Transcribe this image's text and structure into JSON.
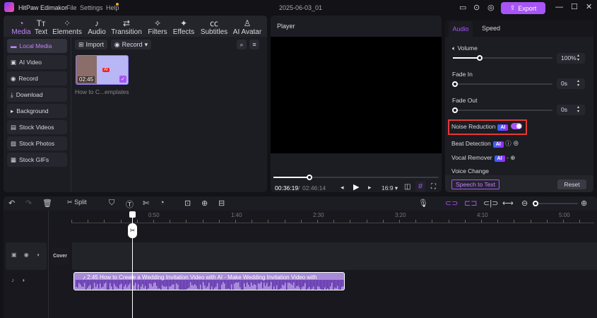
{
  "app": {
    "title": "HitPaw Edimakor",
    "menu": [
      "File",
      "Settings",
      "Help"
    ],
    "project_name": "2025-06-03_01",
    "export_label": "Export",
    "accent": "#a855f7"
  },
  "tabs": [
    {
      "label": "Media",
      "icon": "media-icon"
    },
    {
      "label": "Text",
      "icon": "text-icon"
    },
    {
      "label": "Elements",
      "icon": "elements-icon"
    },
    {
      "label": "Audio",
      "icon": "audio-icon"
    },
    {
      "label": "Transition",
      "icon": "transition-icon"
    },
    {
      "label": "Filters",
      "icon": "filters-icon"
    },
    {
      "label": "Effects",
      "icon": "effects-icon"
    },
    {
      "label": "Subtitles",
      "icon": "subtitles-icon"
    },
    {
      "label": "AI Avatar",
      "icon": "ai-avatar-icon"
    }
  ],
  "sidebar": [
    {
      "label": "Local Media",
      "icon": "folder-icon"
    },
    {
      "label": "AI Video",
      "icon": "ai-video-icon"
    },
    {
      "label": "Record",
      "icon": "record-icon"
    },
    {
      "label": "Download",
      "icon": "download-icon"
    },
    {
      "label": "Background",
      "icon": "play-icon"
    },
    {
      "label": "Stock Videos",
      "icon": "stock-videos-icon"
    },
    {
      "label": "Stock Photos",
      "icon": "stock-photos-icon"
    },
    {
      "label": "Stock GIFs",
      "icon": "stock-gifs-icon"
    }
  ],
  "media": {
    "import_label": "Import",
    "record_label": "Record",
    "item": {
      "duration": "02:45",
      "name": "How to C...emplates",
      "badge": "AI"
    }
  },
  "player": {
    "title": "Player",
    "current_time": "00:36:19",
    "total_time": "02:46:14",
    "aspect": "16:9",
    "progress": 0.22
  },
  "audio_panel": {
    "tabs": [
      "Audio",
      "Speed"
    ],
    "volume_label": "Volume",
    "volume_value": "100%",
    "volume_level": 0.27,
    "fade_in_label": "Fade In",
    "fade_in_value": "0s",
    "fade_out_label": "Fade Out",
    "fade_out_value": "0s",
    "noise_reduction_label": "Noise Reduction",
    "noise_reduction_on": true,
    "beat_detection_label": "Beat Detection",
    "vocal_remover_label": "Vocal Remover",
    "voice_change_label": "Voice Change",
    "ai_badge": "AI",
    "speech_to_text_label": "Speech to Text",
    "reset_label": "Reset"
  },
  "timeline": {
    "split_label": "Split",
    "ruler": [
      "0:50",
      "1:40",
      "2:30",
      "3:20",
      "4:10",
      "5:00"
    ],
    "cover_label": "Cover",
    "clip_title": "2:45 How to Create a Wedding Invitation Video with AI - Make Wedding Invitation Video with"
  }
}
